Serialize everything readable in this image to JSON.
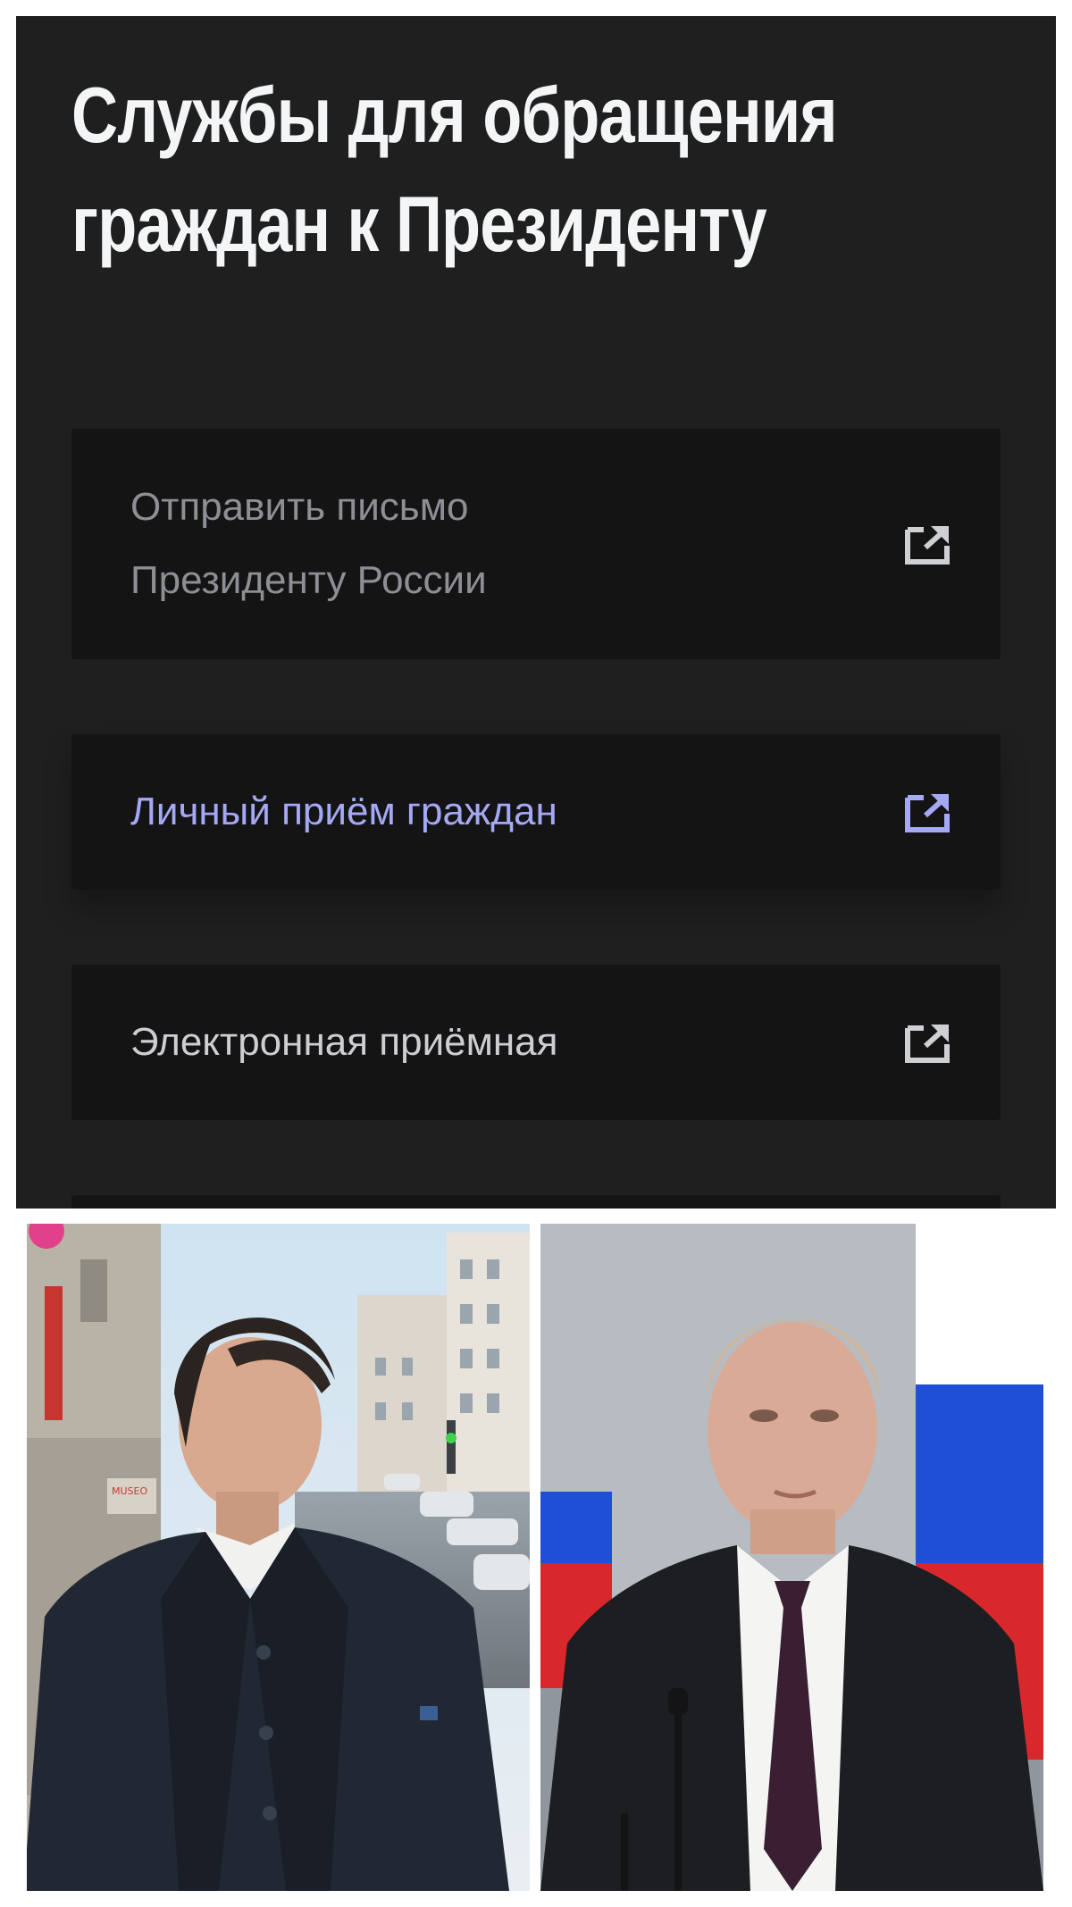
{
  "header": {
    "title_line1": "Службы для обращения",
    "title_line2": "граждан к Президенту"
  },
  "services": {
    "letter": {
      "line1": "Отправить письмо",
      "line2": "Президенту России",
      "icon": "external-link-icon"
    },
    "reception": {
      "label": "Личный приём граждан",
      "icon": "external-link-icon"
    },
    "eoffice": {
      "label": "Электронная приёмная",
      "icon": "external-link-icon"
    }
  },
  "photos": {
    "left_sign_text": "MUSEO",
    "flag_colors": [
      "#ffffff",
      "#1f4fd6",
      "#d8282b"
    ]
  },
  "colors": {
    "panel_bg": "#1f1f20",
    "card_bg": "#141415",
    "accent": "#a5a8f4",
    "title": "#f3f5f7"
  }
}
